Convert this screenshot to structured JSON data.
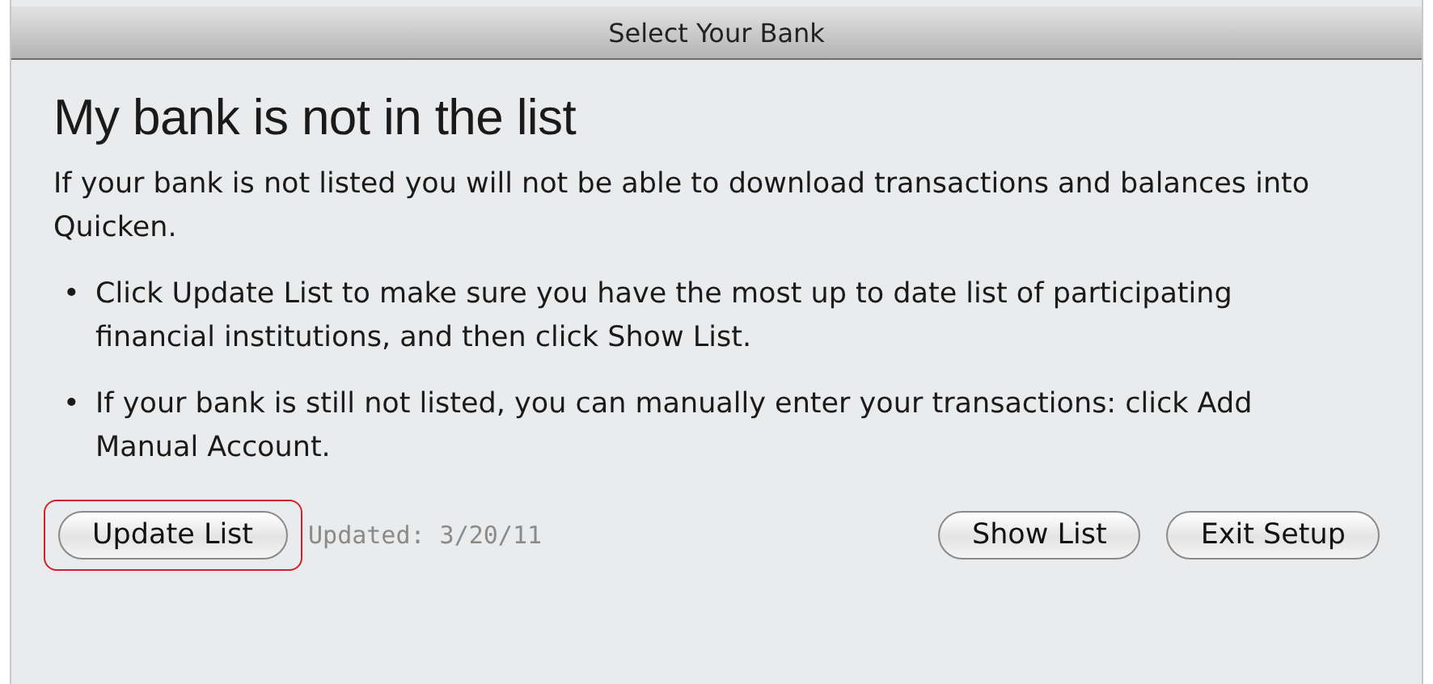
{
  "window": {
    "title": "Select Your Bank"
  },
  "heading": "My bank is not in the list",
  "intro": "If your bank is not listed you will not be able to download transactions and balances into Quicken.",
  "bullets": [
    "Click Update List to make sure you have the most up to date list of participating financial institutions, and then click Show List.",
    "If your bank is still not listed, you can manually enter your transactions: click Add Manual Account."
  ],
  "bullet_mark": "•",
  "update_button": {
    "label": "Update List",
    "highlighted": true
  },
  "updated_note": "Updated: 3/20/11",
  "buttons": [
    {
      "label": "Show List"
    },
    {
      "label": "Exit Setup"
    }
  ]
}
